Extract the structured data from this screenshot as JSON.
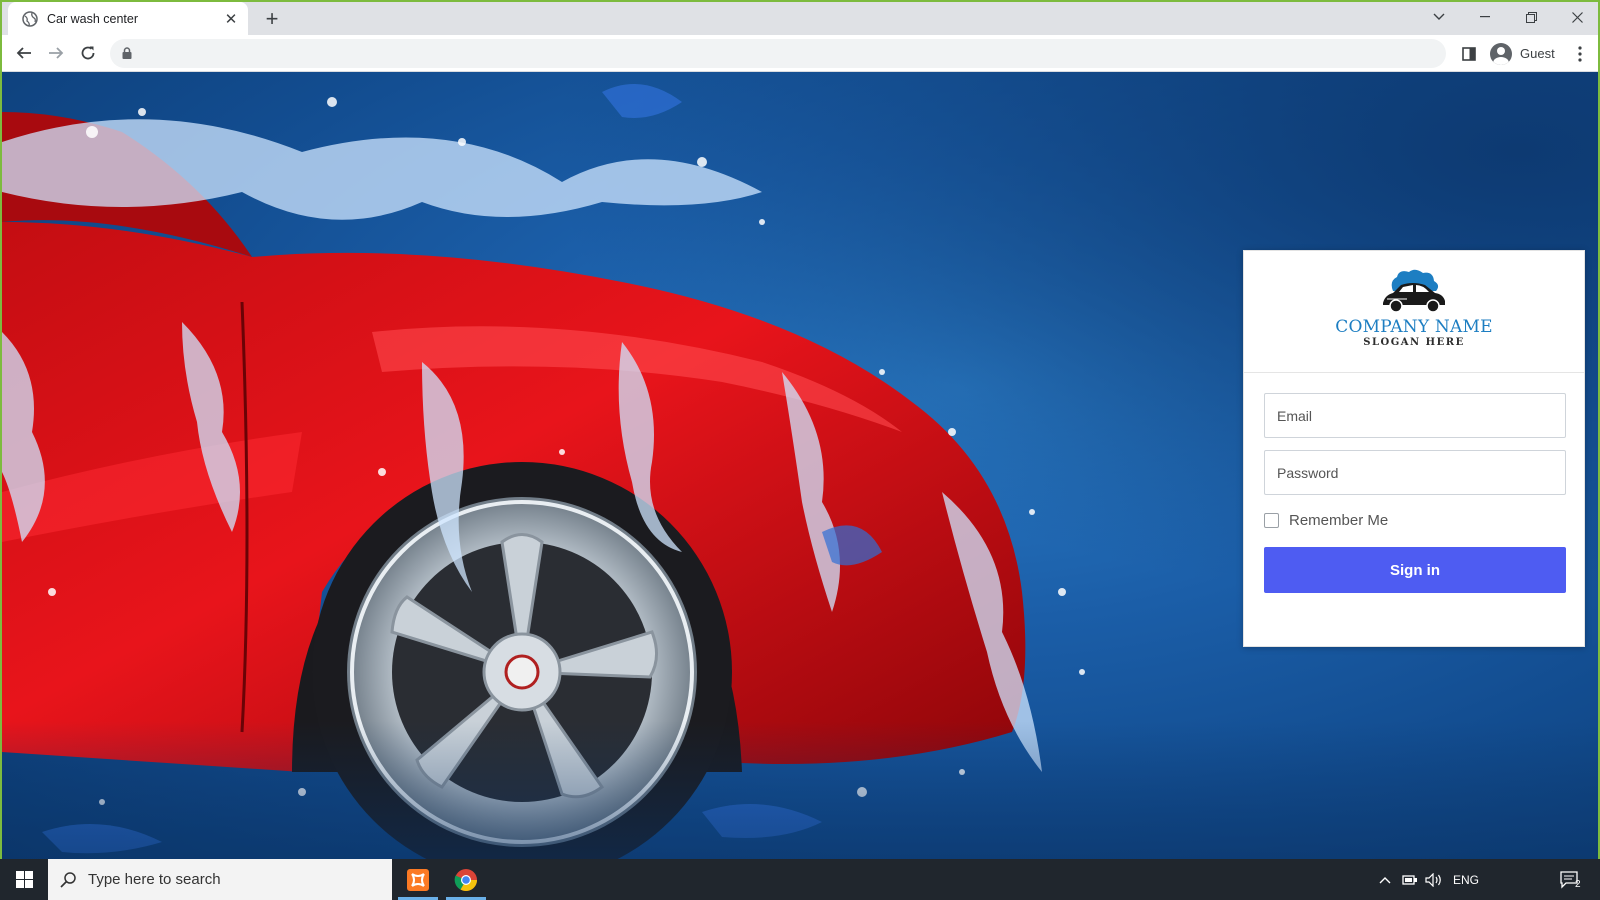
{
  "browser": {
    "tab_title": "Car wash center",
    "new_tab_label": "+",
    "close_tab_label": "✕",
    "url": "",
    "profile_name": "Guest"
  },
  "login": {
    "company_name": "COMPANY NAME",
    "slogan": "SLOGAN HERE",
    "email_placeholder": "Email",
    "password_placeholder": "Password",
    "remember_label": "Remember Me",
    "signin_label": "Sign in",
    "accent_color": "#4e5cf2",
    "brand_color": "#1d7ec2"
  },
  "taskbar": {
    "search_placeholder": "Type here to search",
    "language": "ENG",
    "notification_count": "2"
  }
}
